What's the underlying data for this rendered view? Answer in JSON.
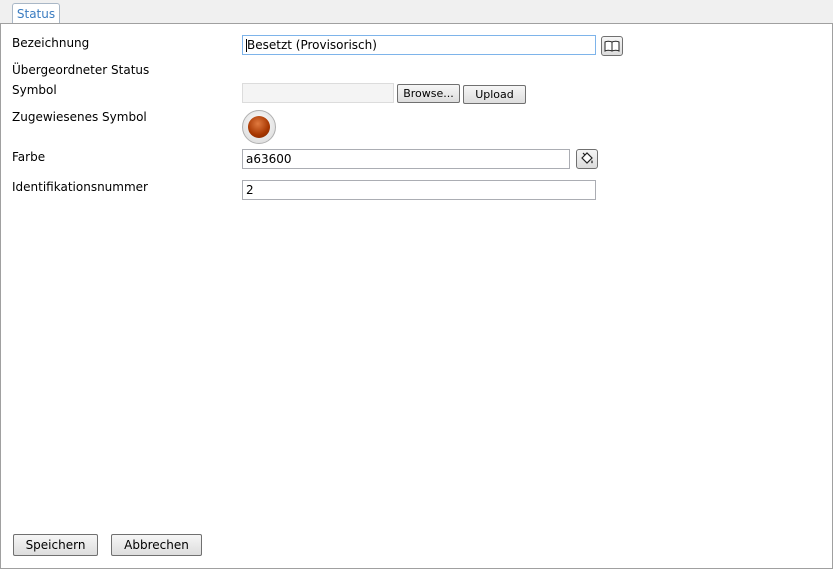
{
  "tabs": [
    {
      "label": "Status"
    }
  ],
  "form": {
    "bezeichnung": {
      "label": "Bezeichnung",
      "value": "Besetzt (Provisorisch)"
    },
    "uebergeordneter_status": {
      "label": "Übergeordneter Status"
    },
    "symbol": {
      "label": "Symbol",
      "file_value": "",
      "browse_label": "Browse...",
      "upload_label": "Upload"
    },
    "zugewiesenes_symbol": {
      "label": "Zugewiesenes Symbol",
      "color": "#a63600"
    },
    "farbe": {
      "label": "Farbe",
      "value": "a63600"
    },
    "identifikationsnummer": {
      "label": "Identifikationsnummer",
      "value": "2"
    }
  },
  "actions": {
    "save_label": "Speichern",
    "cancel_label": "Abbrechen"
  },
  "icons": {
    "dictionary": "book-icon",
    "color_picker": "paint-bucket-icon"
  },
  "colors": {
    "tab_text": "#3a7cc1",
    "accent": "#a63600"
  }
}
